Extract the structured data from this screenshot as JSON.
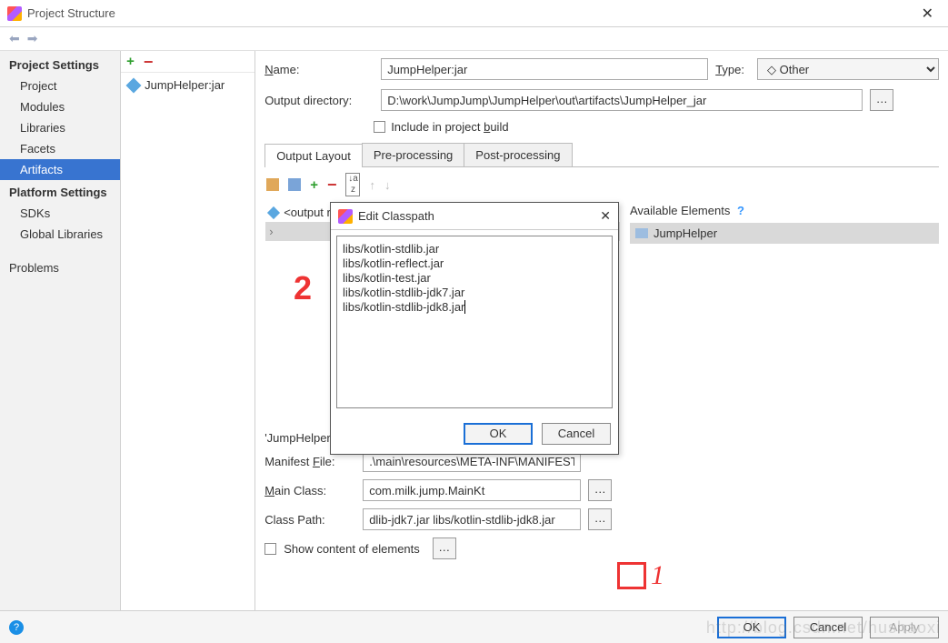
{
  "window": {
    "title": "Project Structure"
  },
  "sidebar": {
    "section1": "Project Settings",
    "items1": [
      "Project",
      "Modules",
      "Libraries",
      "Facets",
      "Artifacts"
    ],
    "section2": "Platform Settings",
    "items2": [
      "SDKs",
      "Global Libraries"
    ],
    "section3": "Problems"
  },
  "midlist": {
    "item": "JumpHelper:jar"
  },
  "form": {
    "name_lbl": "Name:",
    "name_val": "JumpHelper:jar",
    "type_lbl": "Type:",
    "type_val": "Other",
    "outdir_lbl": "Output directory:",
    "outdir_val": "D:\\work\\JumpJump\\JumpHelper\\out\\artifacts\\JumpHelper_jar",
    "include_lbl": "Include in project build",
    "tabs": [
      "Output Layout",
      "Pre-processing",
      "Post-processing"
    ],
    "outroot": "<output root>",
    "avail_hdr": "Available Elements",
    "avail_item": "JumpHelper",
    "manifest_hdr": "'JumpHelper.jar' manifest properties:",
    "mf_file_lbl": "Manifest File:",
    "mf_file_val": ".\\main\\resources\\META-INF\\MANIFEST.MF",
    "main_lbl": "Main Class:",
    "main_val": "com.milk.jump.MainKt",
    "cp_lbl": "Class Path:",
    "cp_val": "dlib-jdk7.jar libs/kotlin-stdlib-jdk8.jar",
    "show_lbl": "Show content of elements"
  },
  "dialog": {
    "title": "Edit Classpath",
    "lines": "libs/kotlin-stdlib.jar\nlibs/kotlin-reflect.jar\nlibs/kotlin-test.jar\nlibs/kotlin-stdlib-jdk7.jar\nlibs/kotlin-stdlib-jdk8.jar",
    "ok": "OK",
    "cancel": "Cancel"
  },
  "footer": {
    "ok": "OK",
    "cancel": "Cancel",
    "apply": "Apply"
  },
  "watermark": "http://blog.csdn.net/hushaoxi",
  "annot": {
    "two": "2",
    "one": "1"
  }
}
